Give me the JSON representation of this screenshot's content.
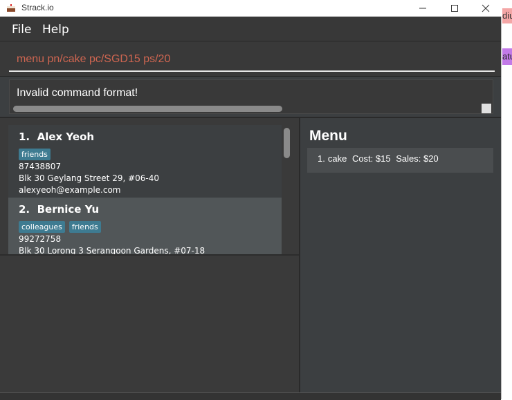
{
  "window": {
    "title": "Strack.io",
    "controls": [
      "minimize-icon",
      "maximize-icon",
      "close-icon"
    ]
  },
  "menubar": {
    "items": [
      {
        "label": "File"
      },
      {
        "label": "Help"
      }
    ]
  },
  "command": {
    "value": "menu pn/cake pc/SGD15 ps/20",
    "text_color": "#d06651"
  },
  "result": {
    "message": "Invalid command format!"
  },
  "persons": [
    {
      "index": "1.",
      "name": "Alex Yeoh",
      "tags": [
        "friends"
      ],
      "phone": "87438807",
      "address": "Blk 30 Geylang Street 29, #06-40",
      "email": "alexyeoh@example.com"
    },
    {
      "index": "2.",
      "name": "Bernice Yu",
      "tags": [
        "colleagues",
        "friends"
      ],
      "phone": "99272758",
      "address": "Blk 30 Lorong 3 Serangoon Gardens, #07-18",
      "email": ""
    }
  ],
  "menu_panel": {
    "title": "Menu",
    "items": [
      {
        "index": "1.",
        "name": "cake",
        "cost": "Cost: $15",
        "sales": "Sales: $20"
      }
    ]
  },
  "background_app": {
    "chip1": "diu",
    "chip2": "atu"
  },
  "colors": {
    "tag_bg": "#3e7b91",
    "selected_card_bg": "#515658",
    "window_bg": "#3c3f41"
  }
}
